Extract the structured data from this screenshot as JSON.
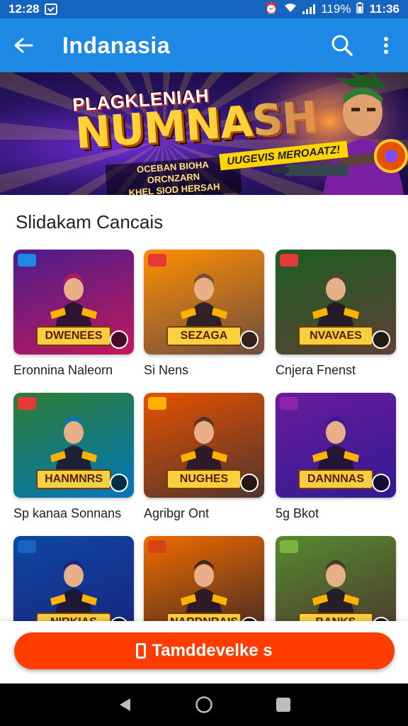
{
  "status_bar": {
    "time_left": "12:28",
    "battery": "119%",
    "time_right": "11:36"
  },
  "app_bar": {
    "title": "Indanasia",
    "back_icon": "arrow-left-icon",
    "search_icon": "search-icon",
    "more_icon": "more-vert-icon"
  },
  "banner": {
    "tagline": "UUGEVIS MEROAATZ!",
    "kicker": "PLAGKLENIAH",
    "headline": "NUMNASH",
    "sub_line_1": "OCEBAN BIOHA ORCNZARN",
    "sub_line_2": "KHEL SIOD HERSAH"
  },
  "section": {
    "title": "Slidakam Cancais"
  },
  "games": [
    {
      "thumb_title": "DWENEES",
      "label": "Eronnina Naleorn",
      "bg": "#4a1d8c",
      "bg2": "#c2185b",
      "badge": "#1e88e5"
    },
    {
      "thumb_title": "SEZAGA",
      "label": "Si Nens",
      "bg": "#ff8f00",
      "bg2": "#6d4c41",
      "badge": "#e53935"
    },
    {
      "thumb_title": "NVAVAES",
      "label": "Cnjera Fnenst",
      "bg": "#1b5e20",
      "bg2": "#5d4037",
      "badge": "#e53935"
    },
    {
      "thumb_title": "HANMNRS",
      "label": "Sp kanaa Sonnans",
      "bg": "#2e7d32",
      "bg2": "#0277bd",
      "badge": "#e53935"
    },
    {
      "thumb_title": "NUGHES",
      "label": "Agribgr Ont",
      "bg": "#e65100",
      "bg2": "#4e342e",
      "badge": "#ffb300"
    },
    {
      "thumb_title": "DANNNAS",
      "label": "5g Bkot",
      "bg": "#6a1b9a",
      "bg2": "#311b92",
      "badge": "#8e24aa"
    },
    {
      "thumb_title": "NIRKIAS",
      "label": "",
      "bg": "#0d47a1",
      "bg2": "#1a237e",
      "badge": "#1565c0"
    },
    {
      "thumb_title": "NARDNRAIS",
      "label": "",
      "bg": "#ef6c00",
      "bg2": "#3e2723",
      "badge": "#d84315"
    },
    {
      "thumb_title": "BANKS",
      "label": "",
      "bg": "#558b2f",
      "bg2": "#4e342e",
      "badge": "#7cb342"
    }
  ],
  "cta": {
    "label": "Tamddevelke s"
  },
  "colors": {
    "status_bar": "#1565c0",
    "app_bar": "#1e88e5",
    "cta": "#ff3d00"
  }
}
